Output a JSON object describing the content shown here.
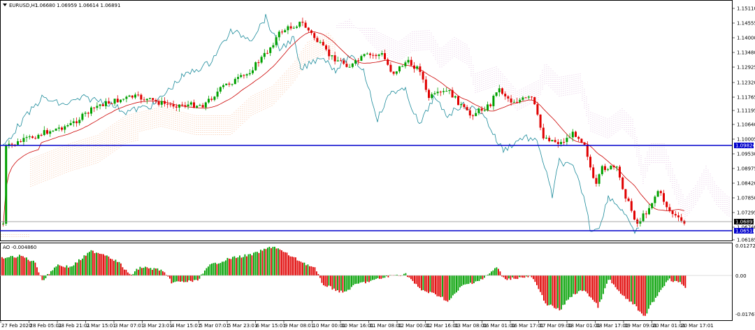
{
  "header": {
    "symbol": "EURUSD,H1",
    "ohlc": "1.06680 1.06959 1.06614 1.06891",
    "indicator": "AO -0.004860",
    "menu_icon": "triangle-down-icon"
  },
  "price_axis": {
    "ticks": [
      "1.15110",
      "1.14555",
      "1.14000",
      "1.13480",
      "1.12925",
      "1.12320",
      "1.11765",
      "1.11195",
      "1.10640",
      "1.10005",
      "1.09530",
      "1.08975",
      "1.08420",
      "1.07850",
      "1.07295",
      "1.06740",
      "1.06185"
    ],
    "labels": {
      "line_upper": "1.09824",
      "line_current": "1.06891",
      "line_lower": "1.06518"
    }
  },
  "ao_axis": {
    "ticks": [
      "0.012728",
      "0.00",
      "-0.017670"
    ]
  },
  "time_axis": {
    "labels": [
      "27 Feb 2020",
      "28 Feb 05:01",
      "28 Feb 21:01",
      "2 Mar 15:01",
      "3 Mar 07:01",
      "3 Mar 23:01",
      "4 Mar 15:01",
      "5 Mar 07:01",
      "5 Mar 23:01",
      "6 Mar 15:01",
      "9 Mar 08:01",
      "10 Mar 00:01",
      "10 Mar 16:01",
      "11 Mar 08:01",
      "12 Mar 00:01",
      "12 Mar 16:01",
      "13 Mar 08:01",
      "16 Mar 01:01",
      "16 Mar 17:01",
      "17 Mar 09:01",
      "18 Mar 01:01",
      "18 Mar 17:01",
      "19 Mar 09:01",
      "20 Mar 01:01",
      "20 Mar 17:01"
    ]
  },
  "colors": {
    "bull": "#00a000",
    "bear": "#e00000",
    "hline": "#0000cc",
    "chikou": "#1a8a9a",
    "ma": "#cc0000",
    "cloud_bull": "#f5a06b",
    "cloud_bear": "#d8a8d8"
  }
}
